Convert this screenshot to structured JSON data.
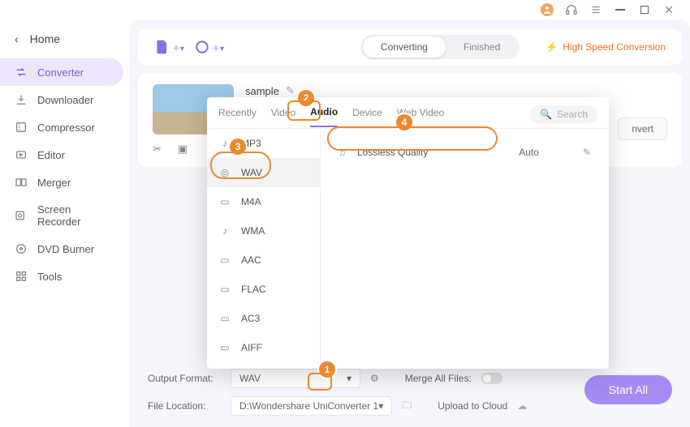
{
  "window": {
    "home": "Home"
  },
  "sidebar": {
    "items": [
      {
        "label": "Converter"
      },
      {
        "label": "Downloader"
      },
      {
        "label": "Compressor"
      },
      {
        "label": "Editor"
      },
      {
        "label": "Merger"
      },
      {
        "label": "Screen Recorder"
      },
      {
        "label": "DVD Burner"
      },
      {
        "label": "Tools"
      }
    ]
  },
  "header": {
    "tab_converting": "Converting",
    "tab_finished": "Finished",
    "high_speed": "High Speed Conversion"
  },
  "file": {
    "name": "sample",
    "convert_label": "nvert"
  },
  "popup": {
    "tabs": {
      "recently": "Recently",
      "video": "Video",
      "audio": "Audio",
      "device": "Device",
      "web": "Web Video"
    },
    "search_placeholder": "Search",
    "formats": [
      {
        "label": "MP3"
      },
      {
        "label": "WAV"
      },
      {
        "label": "M4A"
      },
      {
        "label": "WMA"
      },
      {
        "label": "AAC"
      },
      {
        "label": "FLAC"
      },
      {
        "label": "AC3"
      },
      {
        "label": "AIFF"
      }
    ],
    "quality": {
      "label": "Lossless Quality",
      "value": "Auto"
    }
  },
  "footer": {
    "output_format_label": "Output Format:",
    "output_format_value": "WAV",
    "file_location_label": "File Location:",
    "file_location_value": "D:\\Wondershare UniConverter 1",
    "merge_label": "Merge All Files:",
    "upload_label": "Upload to Cloud",
    "start_all": "Start All"
  },
  "callouts": {
    "1": "1",
    "2": "2",
    "3": "3",
    "4": "4"
  }
}
